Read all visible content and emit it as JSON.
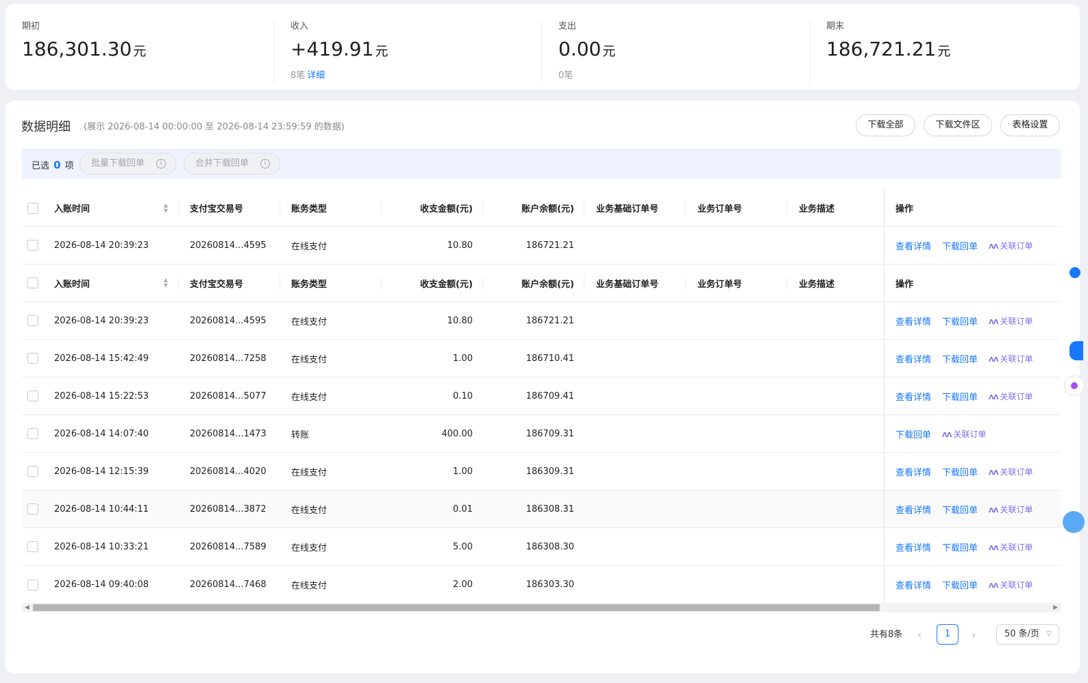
{
  "summary": [
    {
      "label": "期初",
      "value": "186,301.30",
      "unit": "元",
      "sub_count": "",
      "sub_link": ""
    },
    {
      "label": "收入",
      "value": "+419.91",
      "unit": "元",
      "sub_count": "8笔",
      "sub_link": "详细"
    },
    {
      "label": "支出",
      "value": "0.00",
      "unit": "元",
      "sub_count": "0笔",
      "sub_link": ""
    },
    {
      "label": "期末",
      "value": "186,721.21",
      "unit": "元",
      "sub_count": "",
      "sub_link": ""
    }
  ],
  "details": {
    "title": "数据明细",
    "range": "(展示 2026-08-14 00:00:00 至 2026-08-14 23:59:59 的数据)",
    "buttons": {
      "download_all": "下载全部",
      "download_area": "下载文件区",
      "table_settings": "表格设置"
    }
  },
  "selection": {
    "prefix": "已选",
    "count": "0",
    "suffix": "项",
    "batch_download": "批量下载回单",
    "merge_download": "合并下载回单"
  },
  "table": {
    "columns": {
      "time": "入账时间",
      "trade_no": "支付宝交易号",
      "type": "账务类型",
      "amount": "收支金额(元)",
      "balance": "账户余额(元)",
      "biz_order": "业务基础订单号",
      "order": "业务订单号",
      "desc": "业务描述",
      "op": "操作"
    },
    "ops": {
      "view": "查看详情",
      "download": "下载回单",
      "relate": "关联订单"
    },
    "pinned_row": {
      "time": "2026-08-14 20:39:23",
      "trade_no": "20260814...4595",
      "type": "在线支付",
      "amount": "10.80",
      "balance": "186721.21"
    },
    "rows": [
      {
        "time": "2026-08-14 20:39:23",
        "trade_no": "20260814...4595",
        "type": "在线支付",
        "amount": "10.80",
        "balance": "186721.21"
      },
      {
        "time": "2026-08-14 15:42:49",
        "trade_no": "20260814...7258",
        "type": "在线支付",
        "amount": "1.00",
        "balance": "186710.41"
      },
      {
        "time": "2026-08-14 15:22:53",
        "trade_no": "20260814...5077",
        "type": "在线支付",
        "amount": "0.10",
        "balance": "186709.41"
      },
      {
        "time": "2026-08-14 14:07:40",
        "trade_no": "20260814...1473",
        "type": "转账",
        "amount": "400.00",
        "balance": "186709.31"
      },
      {
        "time": "2026-08-14 12:15:39",
        "trade_no": "20260814...4020",
        "type": "在线支付",
        "amount": "1.00",
        "balance": "186309.31"
      },
      {
        "time": "2026-08-14 10:44:11",
        "trade_no": "20260814...3872",
        "type": "在线支付",
        "amount": "0.01",
        "balance": "186308.31"
      },
      {
        "time": "2026-08-14 10:33:21",
        "trade_no": "20260814...7589",
        "type": "在线支付",
        "amount": "5.00",
        "balance": "186308.30"
      },
      {
        "time": "2026-08-14 09:40:08",
        "trade_no": "20260814...7468",
        "type": "在线支付",
        "amount": "2.00",
        "balance": "186303.30"
      }
    ]
  },
  "pagination": {
    "total": "共有8条",
    "current": "1",
    "page_size": "50 条/页"
  },
  "colors": {
    "accent": "#1677ff",
    "relate": "#7b72ea",
    "select_bar": "#eef3fd"
  },
  "icons": [
    "info-icon",
    "sort-icon",
    "relate-icon",
    "chevron-left-icon",
    "chevron-right-icon",
    "chevron-down-icon"
  ]
}
